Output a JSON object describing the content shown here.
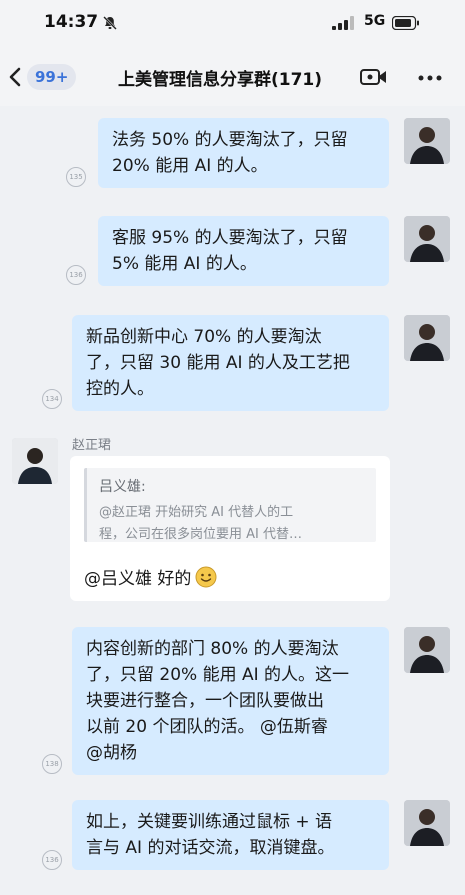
{
  "status_bar": {
    "time": "14:37",
    "network": "5G"
  },
  "header": {
    "unread": "99+",
    "title": "上美管理信息分享群(171)"
  },
  "messages": [
    {
      "lines": [
        "法务 50% 的人要淘汰了，只留",
        "20% 能用 AI 的人。"
      ],
      "read_count": "135"
    },
    {
      "lines": [
        "客服 95% 的人要淘汰了，只留",
        "5% 能用 AI 的人。"
      ],
      "read_count": "136"
    },
    {
      "lines": [
        "新品创新中心 70% 的人要淘汰",
        "了，只留 30 能用 AI 的人及工艺把",
        "控的人。"
      ],
      "read_count": "134"
    }
  ],
  "reply": {
    "sender": "赵正珺",
    "quote_name": "吕义雄:",
    "quote_lines": [
      "@赵正珺 开始研究 AI 代替人的工",
      "程，公司在很多岗位要用 AI 代替…"
    ],
    "text": "@吕义雄 好的"
  },
  "messages_after": [
    {
      "lines": [
        "内容创新的部门 80% 的人要淘汰",
        "了，只留 20% 能用 AI 的人。这一",
        "块要进行整合，一个团队要做出",
        "以前 20 个团队的活。 @伍斯睿",
        "@胡杨"
      ],
      "read_count": "138"
    },
    {
      "lines": [
        "如上，关键要训练通过鼠标 + 语",
        "言与 AI 的对话交流，取消键盘。"
      ],
      "read_count": "136"
    }
  ],
  "colors": {
    "my_bubble": "#d6ebff",
    "accent": "#3b73d9",
    "background": "#eff1f4"
  }
}
